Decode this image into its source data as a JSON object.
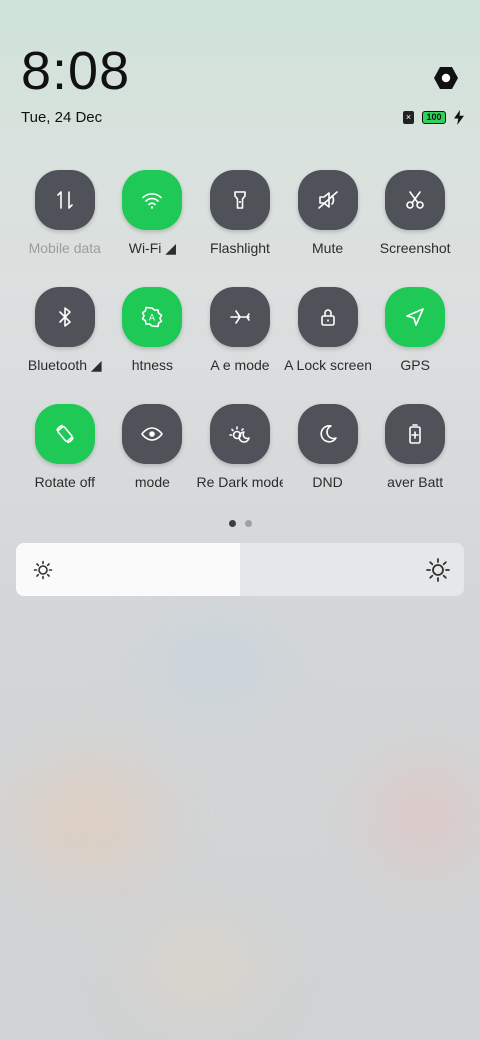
{
  "header": {
    "time": "8:08",
    "date": "Tue, 24 Dec",
    "battery_level": "100",
    "sim_mark": "×"
  },
  "tiles": [
    {
      "label": "Mobile data",
      "icon": "mobile-data-icon",
      "on": false,
      "dim": true
    },
    {
      "label": "Wi-Fi ◢",
      "icon": "wifi-icon",
      "on": true,
      "dim": false
    },
    {
      "label": "Flashlight",
      "icon": "flashlight-icon",
      "on": false,
      "dim": false
    },
    {
      "label": "Mute",
      "icon": "mute-icon",
      "on": false,
      "dim": false
    },
    {
      "label": "Screenshot",
      "icon": "scissors-icon",
      "on": false,
      "dim": false
    },
    {
      "label": "Bluetooth ◢",
      "icon": "bluetooth-icon",
      "on": false,
      "dim": false
    },
    {
      "label": "htness",
      "icon": "auto-brightness-icon",
      "on": true,
      "dim": false
    },
    {
      "label": "A e mode",
      "icon": "airplane-icon",
      "on": false,
      "dim": false
    },
    {
      "label": "A Lock screen",
      "icon": "lock-icon",
      "on": false,
      "dim": false
    },
    {
      "label": "GPS",
      "icon": "location-icon",
      "on": true,
      "dim": false
    },
    {
      "label": "Rotate off",
      "icon": "rotate-icon",
      "on": true,
      "dim": false
    },
    {
      "label": "mode",
      "icon": "eye-icon",
      "on": false,
      "dim": false
    },
    {
      "label": "Re Dark mode",
      "icon": "dark-mode-icon",
      "on": false,
      "dim": false
    },
    {
      "label": "DND",
      "icon": "moon-icon",
      "on": false,
      "dim": false
    },
    {
      "label": "aver Batt",
      "icon": "battery-saver-icon",
      "on": false,
      "dim": false
    }
  ],
  "pager": {
    "pages": 2,
    "active": 0
  },
  "brightness": {
    "level": 0.5
  },
  "colors": {
    "accent_on": "#1fc956",
    "tile_off": "#4f5259"
  }
}
